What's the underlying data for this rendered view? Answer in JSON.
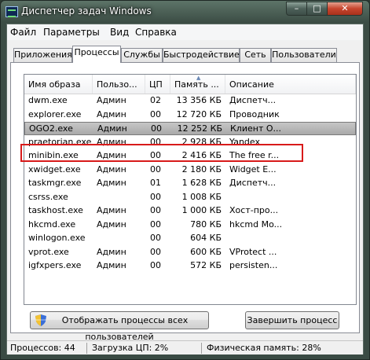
{
  "window": {
    "title": "Диспетчер задач Windows",
    "minimize": "–",
    "maximize": "□",
    "close": "✕"
  },
  "menu": [
    "Файл",
    "Параметры",
    "Вид",
    "Справка"
  ],
  "tabs": [
    "Приложения",
    "Процессы",
    "Службы",
    "Быстродействие",
    "Сеть",
    "Пользователи"
  ],
  "active_tab": "Процессы",
  "columns": [
    "Имя образа",
    "Пользо...",
    "ЦП",
    "Память ...",
    "Описание"
  ],
  "sorted_column": "Память ...",
  "rows": [
    [
      "dwm.exe",
      "Админ",
      "02",
      "13 356 КБ",
      "Диспетч..."
    ],
    [
      "explorer.exe",
      "Админ",
      "00",
      "12 720 КБ",
      "Проводник"
    ],
    [
      "OGO2.exe",
      "Админ",
      "00",
      "12 252 КБ",
      "Клиент О..."
    ],
    [
      "praetorian.exe",
      "Админ",
      "00",
      "2 928 КБ",
      "Yandex"
    ],
    [
      "minibin.exe",
      "Админ",
      "00",
      "2 416 КБ",
      "The free r..."
    ],
    [
      "xwidget.exe",
      "Админ",
      "00",
      "2 180 КБ",
      "Widget E..."
    ],
    [
      "taskmgr.exe",
      "Админ",
      "01",
      "1 628 КБ",
      "Диспетч..."
    ],
    [
      "csrss.exe",
      "",
      "00",
      "1 008 КБ",
      ""
    ],
    [
      "taskhost.exe",
      "Админ",
      "00",
      "1 000 КБ",
      "Хост-про..."
    ],
    [
      "hkcmd.exe",
      "Админ",
      "00",
      "780 КБ",
      "hkcmd Mo..."
    ],
    [
      "winlogon.exe",
      "",
      "00",
      "604 КБ",
      ""
    ],
    [
      "vprot.exe",
      "Админ",
      "00",
      "600 КБ",
      "VProtect ..."
    ],
    [
      "igfxpers.exe",
      "Админ",
      "00",
      "572 КБ",
      "persisten..."
    ]
  ],
  "selected_row": "OGO2.exe",
  "buttons": {
    "show_all": "Отображать процессы всех пользователей",
    "end_process": "Завершить процесс"
  },
  "status": {
    "processes": "Процессов: 44",
    "cpu": "Загрузка ЦП: 2%",
    "memory": "Физическая память: 28%"
  }
}
